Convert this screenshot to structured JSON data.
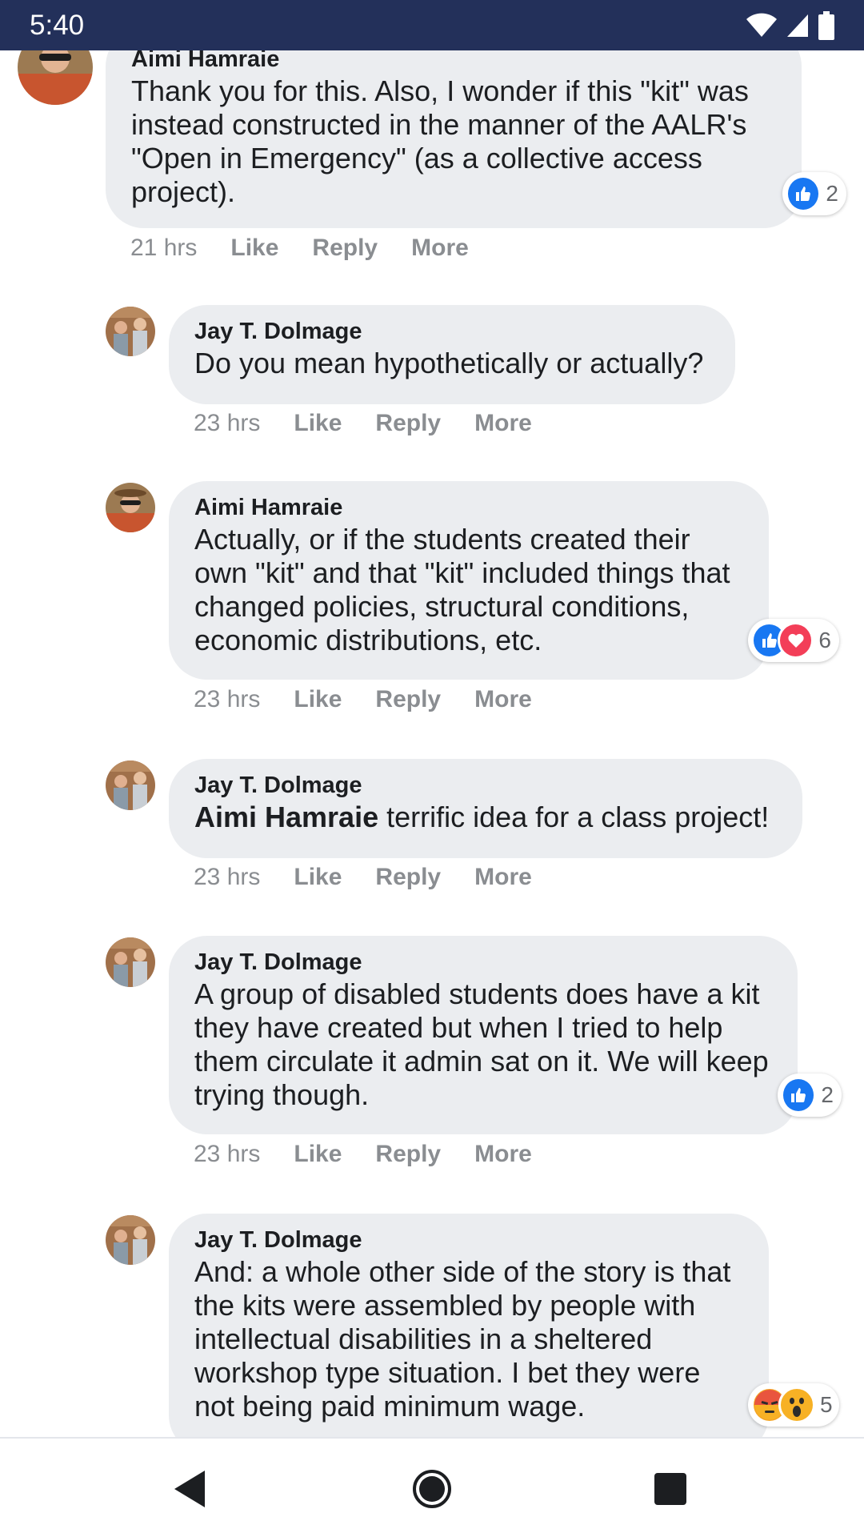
{
  "status_bar": {
    "time": "5:40",
    "icons": [
      "wifi-icon",
      "cellular-signal-icon",
      "battery-icon"
    ]
  },
  "colors": {
    "status_bar_bg": "#23305a",
    "bubble_bg": "#ebedf0",
    "like_blue": "#1877f2",
    "love_red": "#f33e58",
    "muted_text": "#8a8d91"
  },
  "comments": [
    {
      "author": "Aimi Hamraie",
      "text": "Thank you for this. Also, I wonder if this \"kit\" was instead constructed in the manner of the AALR's \"Open in Emergency\" (as a collective access project).",
      "time": "21 hrs",
      "actions": [
        "Like",
        "Reply",
        "More"
      ],
      "reactions": {
        "icons": [
          "like-icon"
        ],
        "count": "2"
      }
    },
    {
      "author": "Jay T. Dolmage",
      "text": "Do you mean hypothetically or actually?",
      "time": "23 hrs",
      "actions": [
        "Like",
        "Reply",
        "More"
      ]
    },
    {
      "author": "Aimi Hamraie",
      "text": "Actually, or if the students created their own \"kit\" and that \"kit\" included things that changed policies, structural conditions, economic distributions, etc.",
      "time": "23 hrs",
      "actions": [
        "Like",
        "Reply",
        "More"
      ],
      "reactions": {
        "icons": [
          "like-icon",
          "love-icon"
        ],
        "count": "6"
      }
    },
    {
      "author": "Jay T. Dolmage",
      "mention": "Aimi Hamraie",
      "text": " terrific idea for a class project!",
      "time": "23 hrs",
      "actions": [
        "Like",
        "Reply",
        "More"
      ]
    },
    {
      "author": "Jay T. Dolmage",
      "text": "A group of disabled students does have a kit they have created but when I tried to help them circulate it admin sat on it. We will keep trying though.",
      "time": "23 hrs",
      "actions": [
        "Like",
        "Reply",
        "More"
      ],
      "reactions": {
        "icons": [
          "like-icon"
        ],
        "count": "2"
      }
    },
    {
      "author": "Jay T. Dolmage",
      "text": "And: a whole other side of the story is that the kits were assembled by people with intellectual disabilities in a sheltered workshop type situation. I bet they were not being paid minimum wage.",
      "reactions": {
        "icons": [
          "angry-icon",
          "wow-icon"
        ],
        "count": "5"
      }
    }
  ],
  "nav_bar": {
    "buttons": [
      "back-icon",
      "home-icon",
      "recents-icon"
    ]
  }
}
